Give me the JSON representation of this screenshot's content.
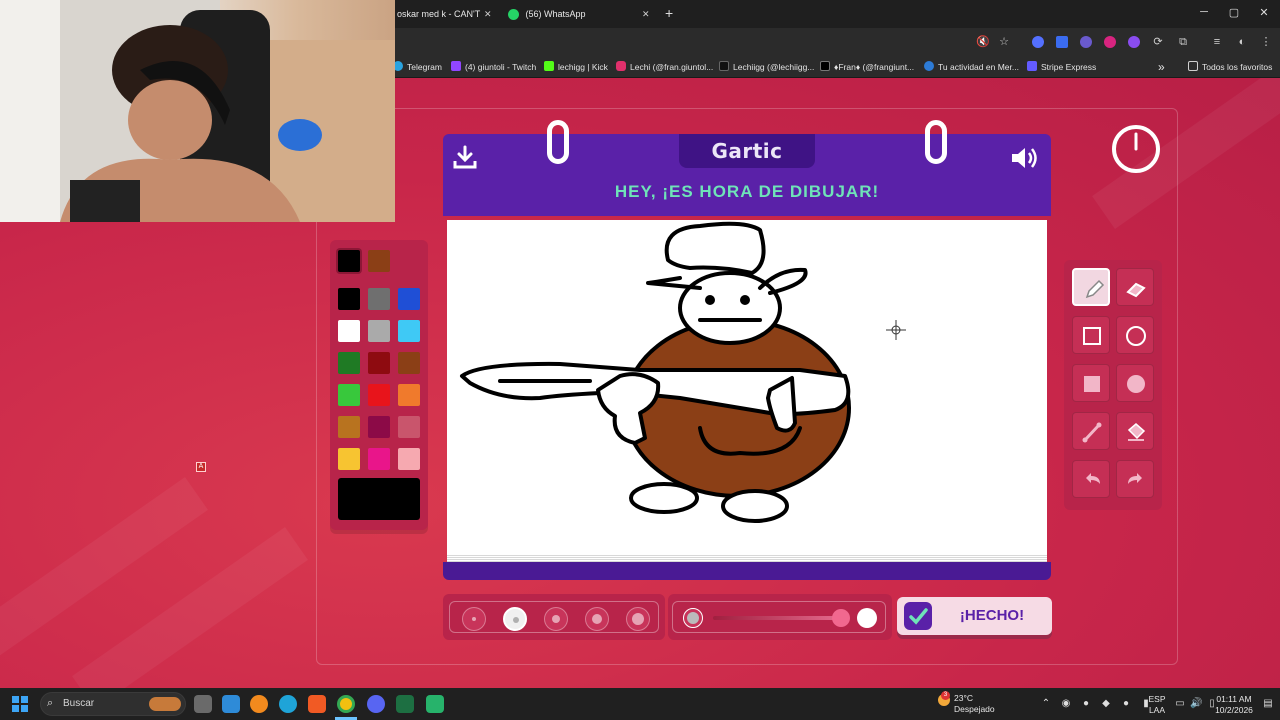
{
  "browser": {
    "tabs": [
      {
        "label": "oskar med k - CAN'T",
        "close": "✕"
      },
      {
        "label": "(56) WhatsApp",
        "close": "✕"
      }
    ],
    "new_tab": "+",
    "window_controls": {
      "minimize": "─",
      "maximize": "▢",
      "close": "✕"
    },
    "bookmarks": [
      "Telegram",
      "(4) giuntoli - Twitch",
      "lechigg | Kick",
      "Lechi (@fran.giuntol...",
      "Lechiigg (@lechiigg...",
      "♦Fran♦ (@frangiunt...",
      "Tu actividad en Mer...",
      "Stripe Express"
    ],
    "bookmarks_overflow": "»",
    "all_bookmarks": "Todos los favoritos"
  },
  "game": {
    "logo": "Gartic",
    "title": "HEY, ¡ES HORA DE DIBUJAR!",
    "done_label": "¡HECHO!",
    "palette": {
      "recent": [
        "#000000",
        "#8b3f16"
      ],
      "colors": [
        "#000000",
        "#6f6f6f",
        "#1f4fd6",
        "#ffffff",
        "#aaaaaa",
        "#3fc9f5",
        "#1f7a24",
        "#8e0b10",
        "#8b3f16",
        "#38c83c",
        "#e8141b",
        "#f07a2c",
        "#b8731f",
        "#8c0a47",
        "#c9556c",
        "#f7c431",
        "#e9158a",
        "#f6a9b0"
      ],
      "current": "#000000"
    },
    "tools": [
      {
        "name": "pencil",
        "icon": "pencil-icon",
        "active": true
      },
      {
        "name": "eraser",
        "icon": "eraser-icon",
        "active": false
      },
      {
        "name": "rectangle",
        "icon": "rectangle-icon",
        "active": false
      },
      {
        "name": "ellipse",
        "icon": "ellipse-icon",
        "active": false
      },
      {
        "name": "filled rectangle",
        "icon": "filled-rectangle-icon",
        "active": false
      },
      {
        "name": "filled ellipse",
        "icon": "filled-ellipse-icon",
        "active": false
      },
      {
        "name": "line",
        "icon": "line-icon",
        "active": false
      },
      {
        "name": "fill",
        "icon": "fill-bucket-icon",
        "active": false
      },
      {
        "name": "undo",
        "icon": "undo-icon",
        "active": false
      },
      {
        "name": "redo",
        "icon": "redo-icon",
        "active": false
      }
    ],
    "brush_sizes": [
      1,
      2,
      3,
      4,
      5
    ],
    "selected_brush_size": 2,
    "opacity_level": 1.0,
    "accent": "#5a21a8",
    "title_color": "#6fe3b8"
  },
  "taskbar": {
    "search_label": "Buscar",
    "weather_temp": "23°C",
    "weather_desc": "Despejado",
    "weather_badge": "3",
    "lang_line1": "ESP",
    "lang_line2": "LAA",
    "time": "01:11 AM",
    "date": "10/2/2026"
  },
  "overlay_marker": "A"
}
